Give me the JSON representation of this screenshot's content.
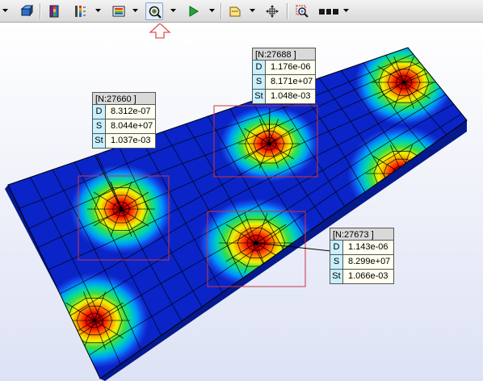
{
  "toolbar": {
    "buttons": [
      {
        "icon": "display-style-icon",
        "has_dropdown": true
      },
      {
        "icon": "result-color-icon",
        "has_dropdown": false
      },
      {
        "icon": "legend-icon",
        "has_dropdown": false
      },
      {
        "icon": "contour-scale-icon",
        "has_dropdown": true
      },
      {
        "icon": "result-select-icon",
        "has_dropdown": true
      },
      {
        "icon": "probe-tool-icon",
        "has_dropdown": true,
        "selected": true
      },
      {
        "icon": "animate-play-icon",
        "has_dropdown": true
      },
      {
        "icon": "section-view-icon",
        "has_dropdown": true
      },
      {
        "icon": "move-crosshair-icon",
        "has_dropdown": false
      },
      {
        "icon": "zoom-window-icon",
        "has_dropdown": false
      },
      {
        "icon": "render-mode-icon",
        "has_dropdown": true
      }
    ]
  },
  "annotation": {
    "icon": "up-arrow-indicator-icon",
    "color": "#e05050"
  },
  "colors": {
    "mesh_base": "#0a24c8",
    "hotspot": "#e00000",
    "highlight_box": "#cc3344",
    "probe_key_bg": "#c8f0ff",
    "probe_value_bg": "#fffff0",
    "probe_title_bg": "#d9d9d9"
  },
  "probes": [
    {
      "id": "probe-27660",
      "title": "[N:27660 ]",
      "rows": [
        {
          "key": "D",
          "value": "8.312e-07"
        },
        {
          "key": "S",
          "value": "8.044e+07"
        },
        {
          "key": "St",
          "value": "1.037e-03"
        }
      ]
    },
    {
      "id": "probe-27688",
      "title": "[N:27688 ]",
      "rows": [
        {
          "key": "D",
          "value": "1.176e-06"
        },
        {
          "key": "S",
          "value": "8.171e+07"
        },
        {
          "key": "St",
          "value": "1.048e-03"
        }
      ]
    },
    {
      "id": "probe-27673",
      "title": "[N:27673 ]",
      "rows": [
        {
          "key": "D",
          "value": "1.143e-06"
        },
        {
          "key": "S",
          "value": "8.299e+07"
        },
        {
          "key": "St",
          "value": "1.066e-03"
        }
      ]
    }
  ]
}
